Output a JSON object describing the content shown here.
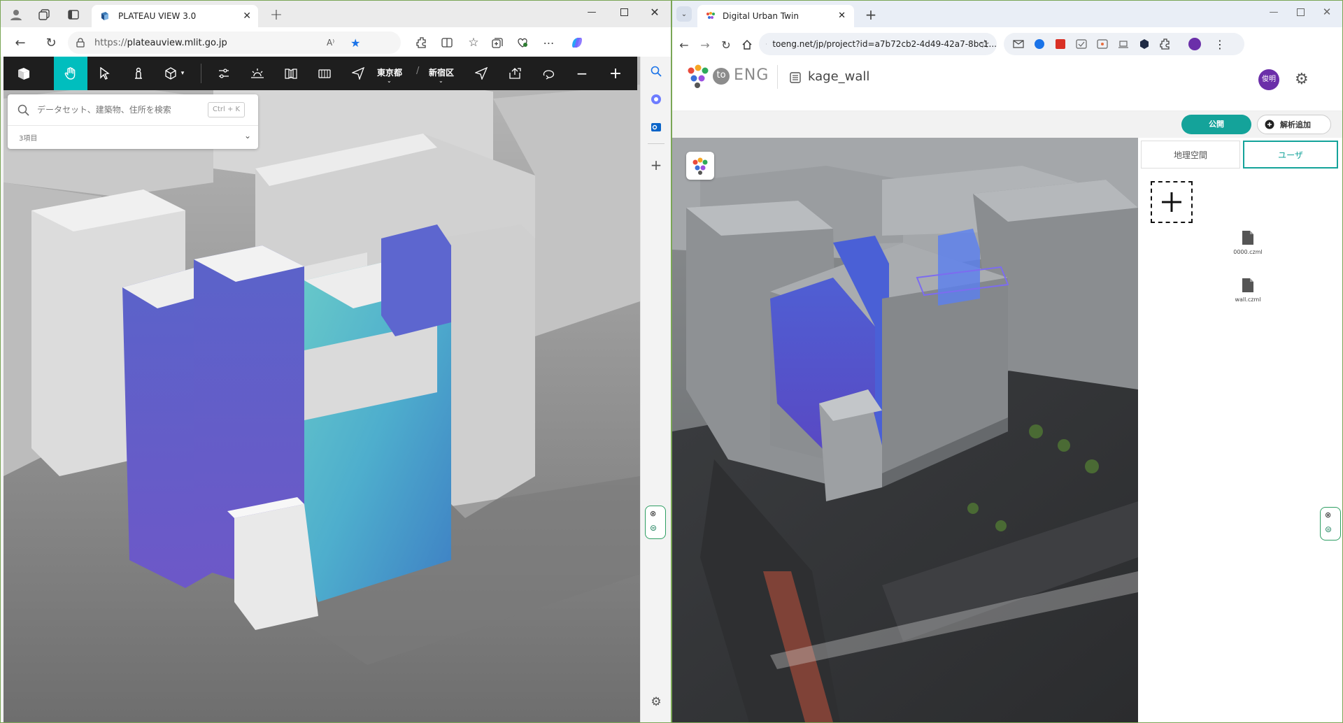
{
  "left": {
    "tab_title": "PLATEAU VIEW 3.0",
    "url": "https://plateauview.mlit.go.jp",
    "url_host": "plateauview.mlit.go.jp",
    "url_scheme": "https://",
    "read_aloud": "A⁾",
    "toolbar": {
      "pref": "東京都",
      "ward": "新宿区",
      "separator": "/"
    },
    "search": {
      "placeholder": "データセット、建築物、住所を検索",
      "shortcut": "Ctrl + K",
      "items_count": "3項目"
    }
  },
  "right": {
    "tab_title": "Digital Urban Twin",
    "url": "toeng.net/jp/project?id=a7b72cb2-4d49-42a7-8bc1...",
    "logo_to": "to",
    "logo_eng": "ENG",
    "project_name": "kage_wall",
    "avatar": "俊明",
    "publish": "公開",
    "add_analysis": "解析追加",
    "tabs": [
      "地理空間",
      "ユーザ"
    ],
    "files": [
      "0000.czml",
      "wall.czml"
    ]
  },
  "colors": {
    "accent_teal": "#14a39a",
    "plateau_active": "#00bebe",
    "edge_blue": "#1a73e8",
    "frame_green": "#7aa656"
  }
}
